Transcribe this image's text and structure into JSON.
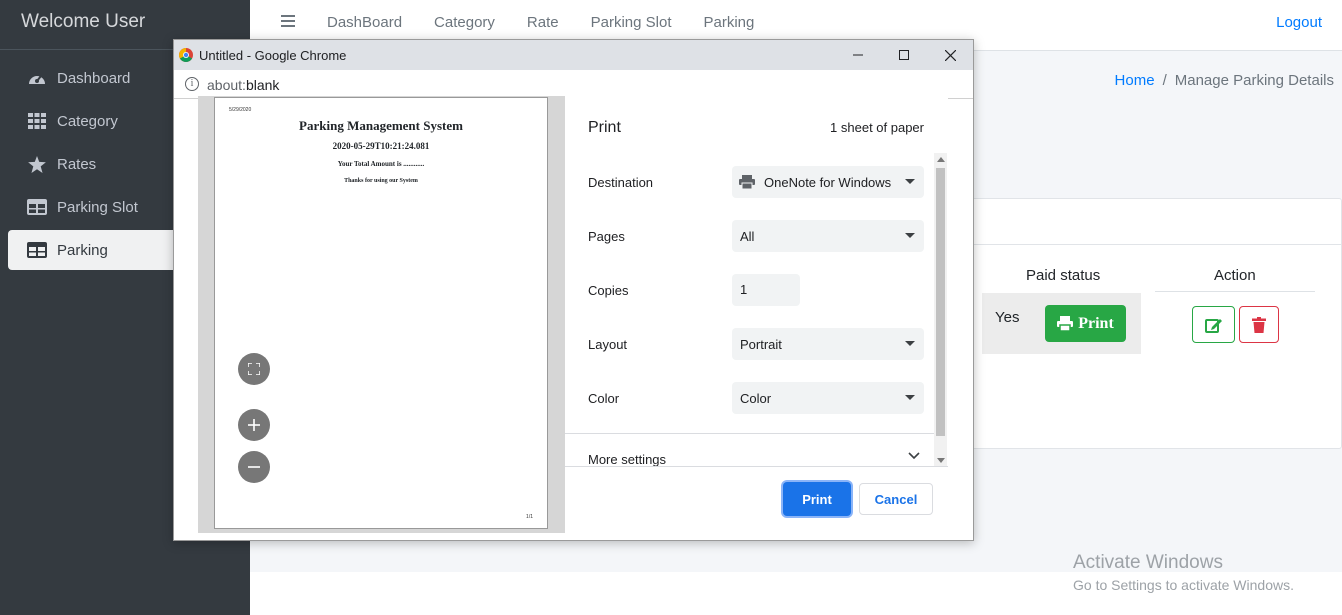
{
  "sidebar": {
    "brand": "Welcome User",
    "items": [
      {
        "label": "Dashboard",
        "icon": "tachometer-icon"
      },
      {
        "label": "Category",
        "icon": "grid-icon"
      },
      {
        "label": "Rates",
        "icon": "star-icon"
      },
      {
        "label": "Parking Slot",
        "icon": "table-icon"
      },
      {
        "label": "Parking",
        "icon": "table-icon",
        "active": true
      }
    ]
  },
  "topbar": {
    "links": [
      "DashBoard",
      "Category",
      "Rate",
      "Parking Slot",
      "Parking"
    ],
    "logout": "Logout"
  },
  "breadcrumb": {
    "home": "Home",
    "separator": "/",
    "current": "Manage Parking Details"
  },
  "table": {
    "headers": {
      "paid_status": "Paid status",
      "action": "Action"
    },
    "row": {
      "paid": "Yes",
      "print_label": "Print"
    }
  },
  "watermark": {
    "line1": "Activate Windows",
    "line2": "Go to Settings to activate Windows."
  },
  "chrome_window": {
    "title": "Untitled - Google Chrome",
    "url_prefix": "about:",
    "url_rest": "blank"
  },
  "preview_sheet": {
    "date": "5/29/2020",
    "heading": "Parking Management System",
    "timestamp": "2020-05-29T10:21:24.081",
    "amount_line": "Your Total Amount is ............",
    "thanks": "Thanks for using our System",
    "page_num": "1/1"
  },
  "print_dialog": {
    "title": "Print",
    "sheets": "1 sheet of paper",
    "destination_label": "Destination",
    "destination_value": "OneNote for Windows",
    "pages_label": "Pages",
    "pages_value": "All",
    "copies_label": "Copies",
    "copies_value": "1",
    "layout_label": "Layout",
    "layout_value": "Portrait",
    "color_label": "Color",
    "color_value": "Color",
    "more_settings": "More settings",
    "print_button": "Print",
    "cancel_button": "Cancel"
  },
  "colors": {
    "sidebar_bg": "#343a40",
    "primary": "#007bff",
    "success": "#28a745",
    "danger": "#dc3545",
    "chrome_blue": "#1a73e8"
  }
}
